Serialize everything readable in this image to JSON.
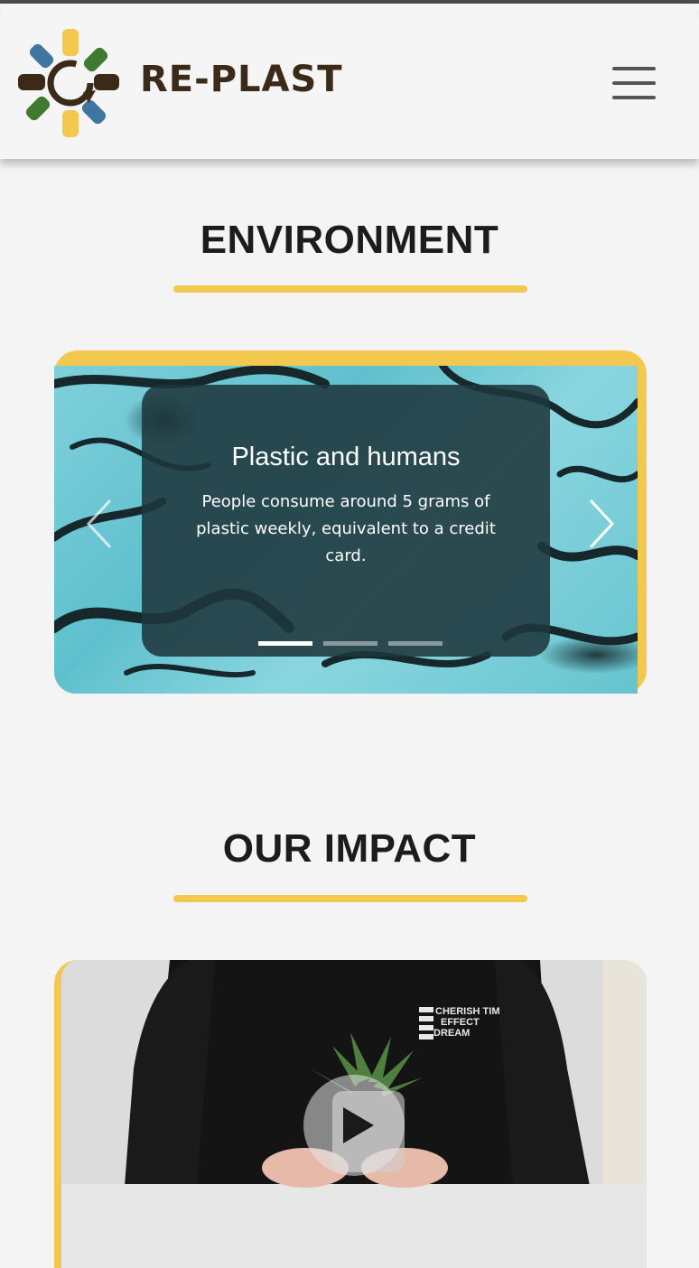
{
  "header": {
    "brand": "RE-PLAST",
    "logo_icon": "recycle-bottles-logo-icon",
    "menu_icon": "hamburger-menu-icon"
  },
  "environment": {
    "title": "ENVIRONMENT",
    "carousel": {
      "slides": [
        {
          "title": "Plastic and humans",
          "text": "People consume around 5 grams of plastic weekly, equivalent to a credit card."
        }
      ],
      "active_index": 0,
      "slide_count": 3,
      "prev_icon": "chevron-left-icon",
      "next_icon": "chevron-right-icon"
    }
  },
  "impact": {
    "title": "OUR IMPACT",
    "video": {
      "play_icon": "play-icon",
      "shirt_text": [
        "CHERISH TIM",
        "EFFECT",
        "DREAM"
      ]
    }
  },
  "colors": {
    "accent": "#f2c84f",
    "brand_text": "#3b2a17",
    "background": "#f4f4f4",
    "caption_overlay": "#1e373c"
  }
}
